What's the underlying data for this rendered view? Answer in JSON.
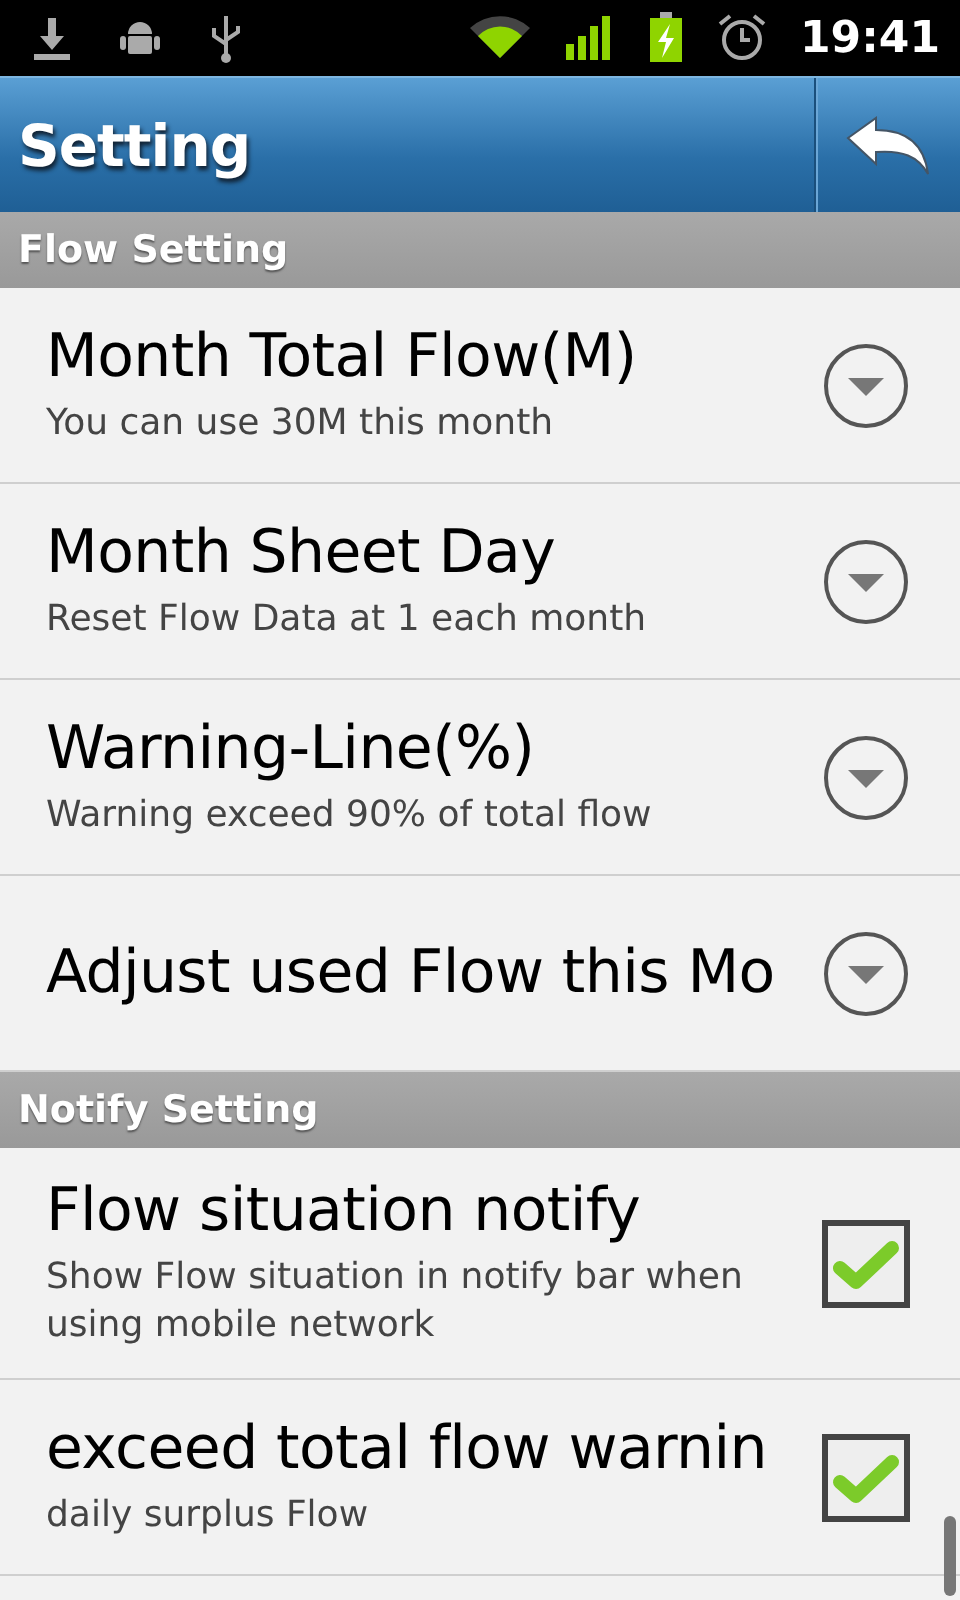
{
  "status_bar": {
    "time": "19:41"
  },
  "title_bar": {
    "title": "Setting"
  },
  "sections": [
    {
      "title": "Flow Setting",
      "items": [
        {
          "kind": "dropdown",
          "title": "Month Total Flow(M)",
          "summary": "You can use 30M this month"
        },
        {
          "kind": "dropdown",
          "title": "Month Sheet Day",
          "summary": "Reset Flow Data at 1 each month"
        },
        {
          "kind": "dropdown",
          "title": "Warning-Line(%)",
          "summary": "Warning exceed 90% of total flow"
        },
        {
          "kind": "dropdown",
          "title": "Adjust used Flow this Mo"
        }
      ]
    },
    {
      "title": "Notify Setting",
      "items": [
        {
          "kind": "checkbox",
          "title": "Flow situation notify",
          "summary": "Show Flow situation in notify bar when using mobile network",
          "checked": true
        },
        {
          "kind": "checkbox",
          "title": "exceed total flow warnin",
          "summary": "daily surplus Flow",
          "checked": true
        }
      ]
    }
  ]
}
